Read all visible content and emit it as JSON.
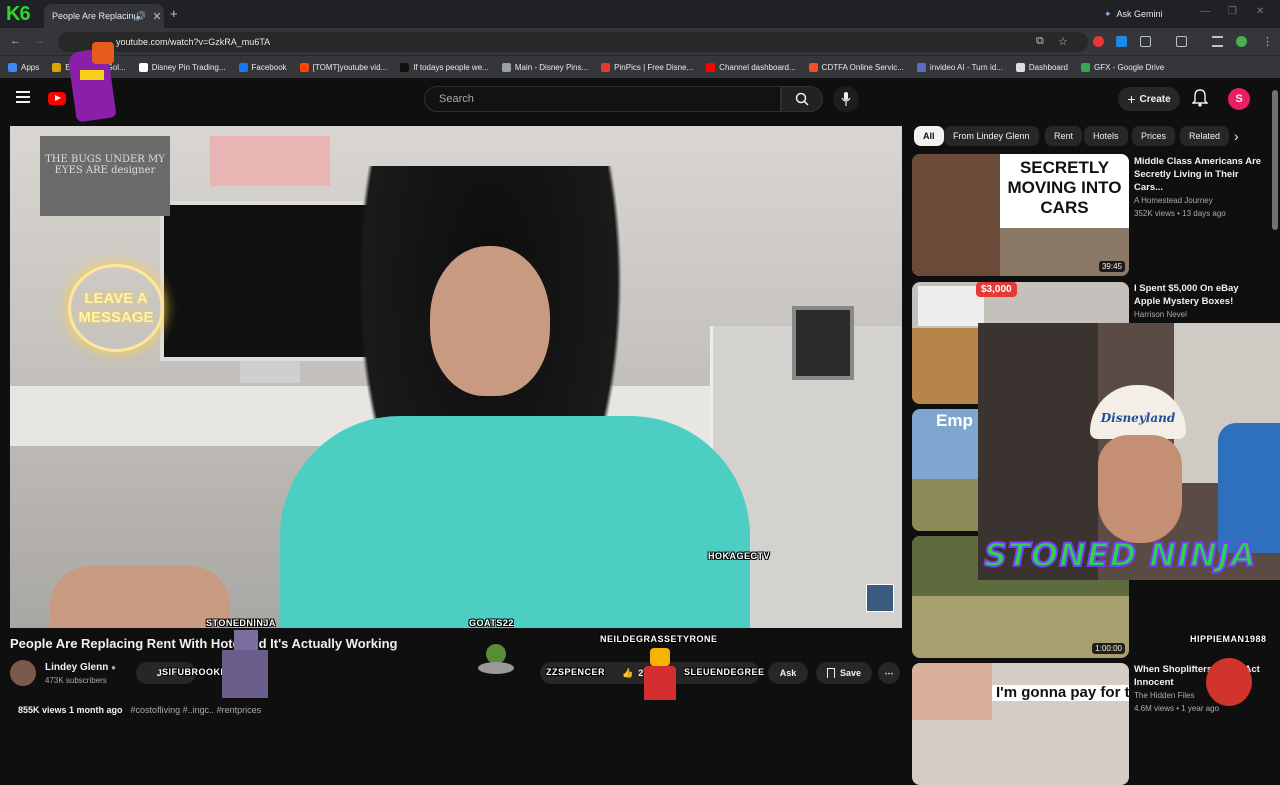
{
  "browser": {
    "tab_title": "People Are Replacing Rent",
    "url": "youtube.com/watch?v=GzkRA_mu6TA",
    "ask_gemini": "Ask Gemini"
  },
  "bookmarks": [
    {
      "label": "Apps",
      "color": "#4285f4"
    },
    {
      "label": "Ex...ensive Gol...",
      "color": "#d9a400"
    },
    {
      "label": "Disney Pin Trading...",
      "color": "#ffffff"
    },
    {
      "label": "Facebook",
      "color": "#1877f2"
    },
    {
      "label": "[TOMT]youtube vid...",
      "color": "#ff4500"
    },
    {
      "label": "If todays people we...",
      "color": "#111111"
    },
    {
      "label": "Main - Disney Pins...",
      "color": "#9aa0a6"
    },
    {
      "label": "PinPics | Free Disne...",
      "color": "#e53935"
    },
    {
      "label": "Channel dashboard...",
      "color": "#ff0000"
    },
    {
      "label": "CDTFA Online Servic...",
      "color": "#f4511e"
    },
    {
      "label": "invideo AI - Turn id...",
      "color": "#5c6bc0"
    },
    {
      "label": "Dashboard",
      "color": "#dddddd"
    },
    {
      "label": "GFX - Google Drive",
      "color": "#34a853"
    }
  ],
  "youtube": {
    "search_placeholder": "Search",
    "create_label": "Create",
    "avatar_letter": "S"
  },
  "video": {
    "neon_sign": "LEAVE A MESSAGE",
    "poster_text": "THE BUGS UNDER MY EYES ARE designer",
    "title": "People Are Replacing Rent With Hote...nd It's Actually Working",
    "channel": "Lindey Glenn",
    "subscribers": "473K subscribers",
    "join_label": "Join",
    "likes": "27K",
    "ask_label": "Ask",
    "save_label": "Save",
    "views_line": "855K views  1 month ago",
    "hashtags": "#costofliving  #..ingc..  #rentprices"
  },
  "chips": [
    "All",
    "From Lindey Glenn",
    "Rent",
    "Hotels",
    "Prices",
    "Related"
  ],
  "recommendations": [
    {
      "title": "Middle Class Americans Are Secretly Living in Their Cars...",
      "channel": "A Homestead Journey",
      "meta": "352K views • 13 days ago",
      "thumb_text": "SECRETLY MOVING INTO CARS",
      "duration": "39:45"
    },
    {
      "title": "I Spent $5,000 On eBay Apple Mystery Boxes!",
      "channel": "Harrison Nevel",
      "meta": "",
      "thumb_text": "$3,000",
      "duration": ""
    },
    {
      "title": "",
      "channel": "",
      "meta": "",
      "thumb_text": "Emp",
      "duration": ""
    },
    {
      "title": "",
      "channel": "",
      "meta": "",
      "thumb_text": "",
      "duration": "1:00:00"
    },
    {
      "title": "When Shoplifters ... and Act Innocent",
      "channel": "The Hidden Files",
      "meta": "4.6M views • 1 year ago",
      "thumb_text": "I'm gonna pay for these",
      "duration": ""
    }
  ],
  "overlay": {
    "webcam_cap_text": "Disneyland",
    "stream_title": "STONED NINJA",
    "k_logo": "K6",
    "usernames": [
      "HOKAGECTV",
      "STONEDNINJA",
      "GOATS22",
      "NEILDEGRASSETYRONE",
      "ZZSPENCER",
      "SLEUENDEGREE",
      "SIFUBROOKLN",
      "HIPPIEMAN1988"
    ]
  }
}
